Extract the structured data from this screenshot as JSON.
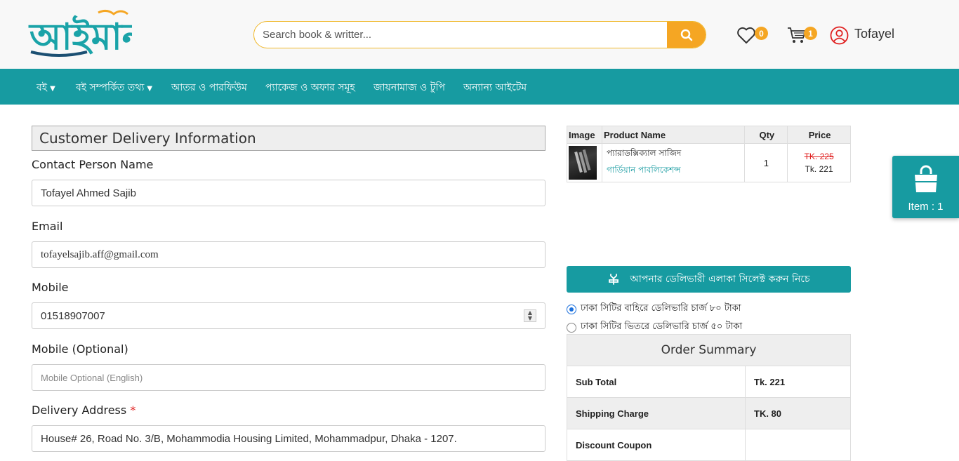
{
  "header": {
    "logo_alt": "আইমান",
    "search_placeholder": "Search book & writter...",
    "wishlist_count": "0",
    "cart_count": "1",
    "user_name": "Tofayel"
  },
  "nav": {
    "items": [
      {
        "label": "বই",
        "dropdown": true
      },
      {
        "label": "বই সম্পর্কিত তথ্য",
        "dropdown": true
      },
      {
        "label": "আতর ও পারফিউম",
        "dropdown": false
      },
      {
        "label": "প্যাকেজ ও অফার সমূহ",
        "dropdown": false
      },
      {
        "label": "জায়নামাজ ও টুপি",
        "dropdown": false
      },
      {
        "label": "অন্যান্য আইটেম",
        "dropdown": false
      }
    ]
  },
  "form": {
    "title": "Customer Delivery Information",
    "contact_label": "Contact Person Name",
    "contact_value": "Tofayel Ahmed Sajib",
    "email_label": "Email",
    "email_value": "tofayelsajib.aff@gmail.com",
    "mobile_label": "Mobile",
    "mobile_value": "01518907007",
    "mobile_opt_label": "Mobile (Optional)",
    "mobile_opt_placeholder": "Mobile Optional (English)",
    "address_label": "Delivery Address",
    "address_required": "*",
    "address_value": "House# 26, Road No. 3/B, Mohammodia Housing Limited, Mohammadpur, Dhaka - 1207."
  },
  "cart": {
    "headers": {
      "image": "Image",
      "name": "Product Name",
      "qty": "Qty",
      "price": "Price"
    },
    "items": [
      {
        "name": "প্যারাডক্সিক্যাল সাজিদ",
        "publisher": "গার্ডিয়ান পাবলিকেশন্স",
        "qty": "1",
        "old_price": "TK. 225",
        "price": "Tk. 221"
      }
    ]
  },
  "delivery": {
    "bar_text": "আপনার ডেলিভারী এলাকা সিলেক্ট করুন নিচে",
    "options": [
      {
        "label": "ঢাকা সিটির বাহিরে ডেলিভারি চার্জ ৮০ টাকা",
        "selected": true
      },
      {
        "label": "ঢাকা সিটির ভিতরে ডেলিভারি চার্জ ৫০ টাকা",
        "selected": false
      }
    ]
  },
  "summary": {
    "title": "Order Summary",
    "rows": [
      {
        "label": "Sub Total",
        "value": "Tk. 221"
      },
      {
        "label": "Shipping Charge",
        "value": "TK. 80"
      },
      {
        "label": "Discount Coupon",
        "value": ""
      }
    ]
  },
  "float_cart": {
    "label": "Item : 1"
  },
  "colors": {
    "teal": "#179ba1",
    "accent": "#f5a623",
    "red": "#e02020"
  }
}
